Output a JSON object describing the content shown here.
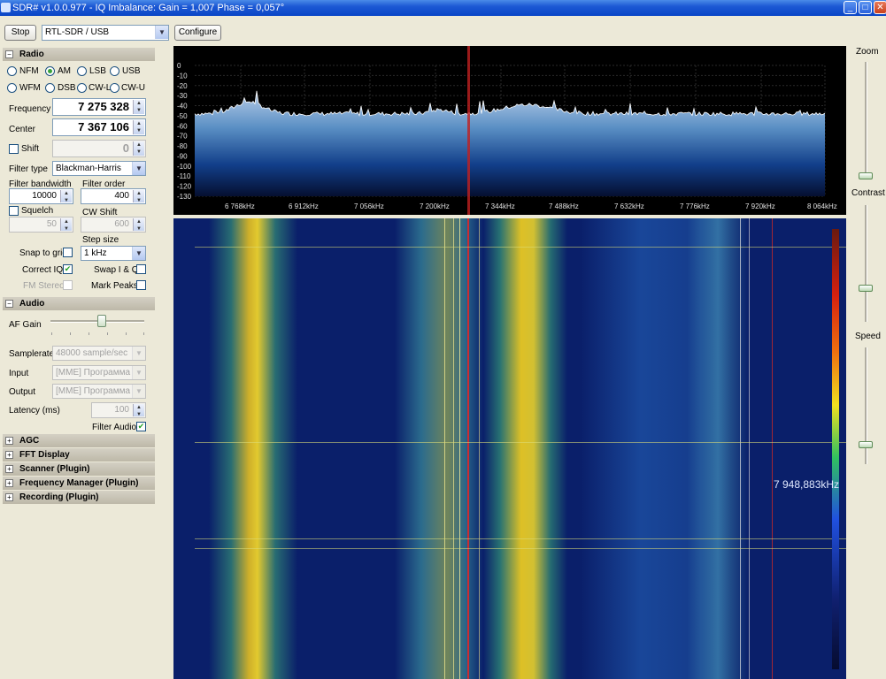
{
  "window": {
    "title": "SDR# v1.0.0.977 - IQ Imbalance: Gain = 1,007 Phase = 0,057°",
    "minimize": "_",
    "maximize": "□",
    "close": "✕"
  },
  "toolbar": {
    "stop_label": "Stop",
    "device": "RTL-SDR / USB",
    "configure_label": "Configure"
  },
  "radio": {
    "header": "Radio",
    "modes": [
      {
        "label": "NFM",
        "selected": false
      },
      {
        "label": "AM",
        "selected": true
      },
      {
        "label": "LSB",
        "selected": false
      },
      {
        "label": "USB",
        "selected": false
      },
      {
        "label": "WFM",
        "selected": false
      },
      {
        "label": "DSB",
        "selected": false
      },
      {
        "label": "CW-L",
        "selected": false
      },
      {
        "label": "CW-U",
        "selected": false
      }
    ],
    "frequency_label": "Frequency",
    "frequency": "7 275 328",
    "center_label": "Center",
    "center": "7 367 106",
    "shift_label": "Shift",
    "shift": "0",
    "filter_type_label": "Filter type",
    "filter_type": "Blackman-Harris",
    "filter_bandwidth_label": "Filter bandwidth",
    "filter_bandwidth": "10000",
    "filter_order_label": "Filter order",
    "filter_order": "400",
    "squelch_label": "Squelch",
    "squelch": "50",
    "cw_shift_label": "CW Shift",
    "cw_shift": "600",
    "step_size_label": "Step size",
    "step_size": "1 kHz",
    "snap_to_grid_label": "Snap to grid",
    "correct_iq_label": "Correct IQ",
    "swap_iq_label": "Swap I & Q",
    "fm_stereo_label": "FM Stereo",
    "mark_peaks_label": "Mark Peaks"
  },
  "audio": {
    "header": "Audio",
    "af_gain_label": "AF Gain",
    "af_gain_level": 0.55,
    "samplerate_label": "Samplerate",
    "samplerate": "48000 sample/sec",
    "input_label": "Input",
    "input": "[MME] Программа пер",
    "output_label": "Output",
    "output": "[MME] Программа пер",
    "latency_label": "Latency (ms)",
    "latency": "100",
    "filter_audio_label": "Filter Audio"
  },
  "collapsed_sections": [
    "AGC",
    "FFT Display",
    "Scanner (Plugin)",
    "Frequency Manager (Plugin)",
    "Recording (Plugin)"
  ],
  "right_controls": {
    "zoom_label": "Zoom",
    "contrast_label": "Contrast",
    "speed_label": "Speed"
  },
  "spectrum": {
    "db_ticks": [
      "0",
      "-10",
      "-20",
      "-30",
      "-40",
      "-50",
      "-60",
      "-70",
      "-80",
      "-90",
      "-100",
      "-110",
      "-120",
      "-130"
    ],
    "freq_ticks": [
      "6 768kHz",
      "6 912kHz",
      "7 056kHz",
      "7 200kHz",
      "7 344kHz",
      "7 488kHz",
      "7 632kHz",
      "7 776kHz",
      "7 920kHz",
      "8 064kHz"
    ]
  },
  "waterfall": {
    "cursor_frequency": "7 948,883kHz"
  }
}
